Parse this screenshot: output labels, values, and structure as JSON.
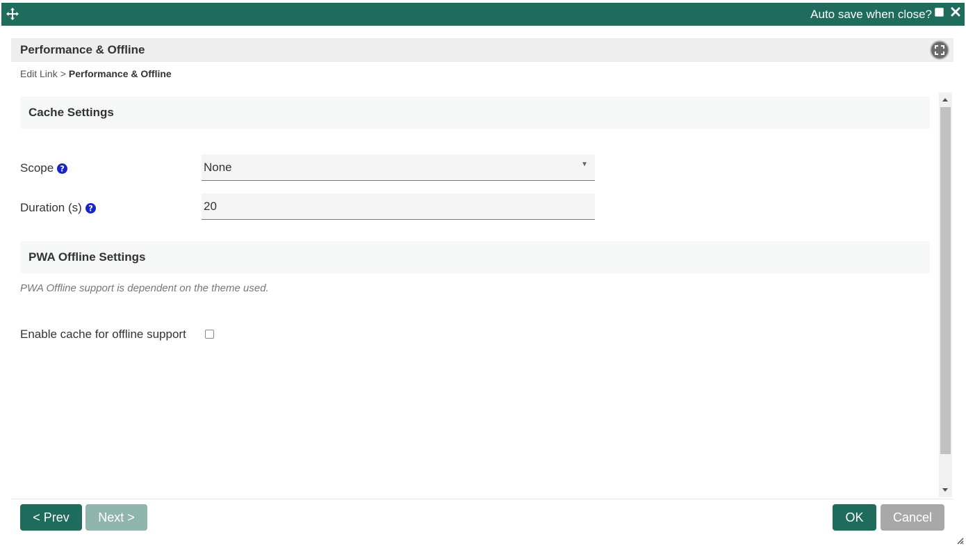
{
  "titlebar": {
    "autosave_label": "Auto save when close?",
    "move_icon": "move-icon",
    "close_icon": "close-icon"
  },
  "header": {
    "title": "Performance & Offline",
    "fullscreen_icon": "fullscreen-icon"
  },
  "breadcrumb": {
    "parent": "Edit Link",
    "separator": ">",
    "current": "Performance & Offline"
  },
  "cache_section": {
    "title": "Cache Settings",
    "scope_label": "Scope",
    "scope_value": "None",
    "duration_label": "Duration (s)",
    "duration_value": "20"
  },
  "pwa_section": {
    "title": "PWA Offline Settings",
    "note": "PWA Offline support is dependent on the theme used.",
    "enable_label": "Enable cache for offline support",
    "enable_checked": false
  },
  "footer": {
    "prev_label": "< Prev",
    "next_label": "Next >",
    "ok_label": "OK",
    "cancel_label": "Cancel"
  },
  "colors": {
    "primary": "#1f6b5c",
    "primary_disabled": "#8fb5ad",
    "cancel": "#a8a8a8",
    "help_icon": "#1a24c8"
  }
}
